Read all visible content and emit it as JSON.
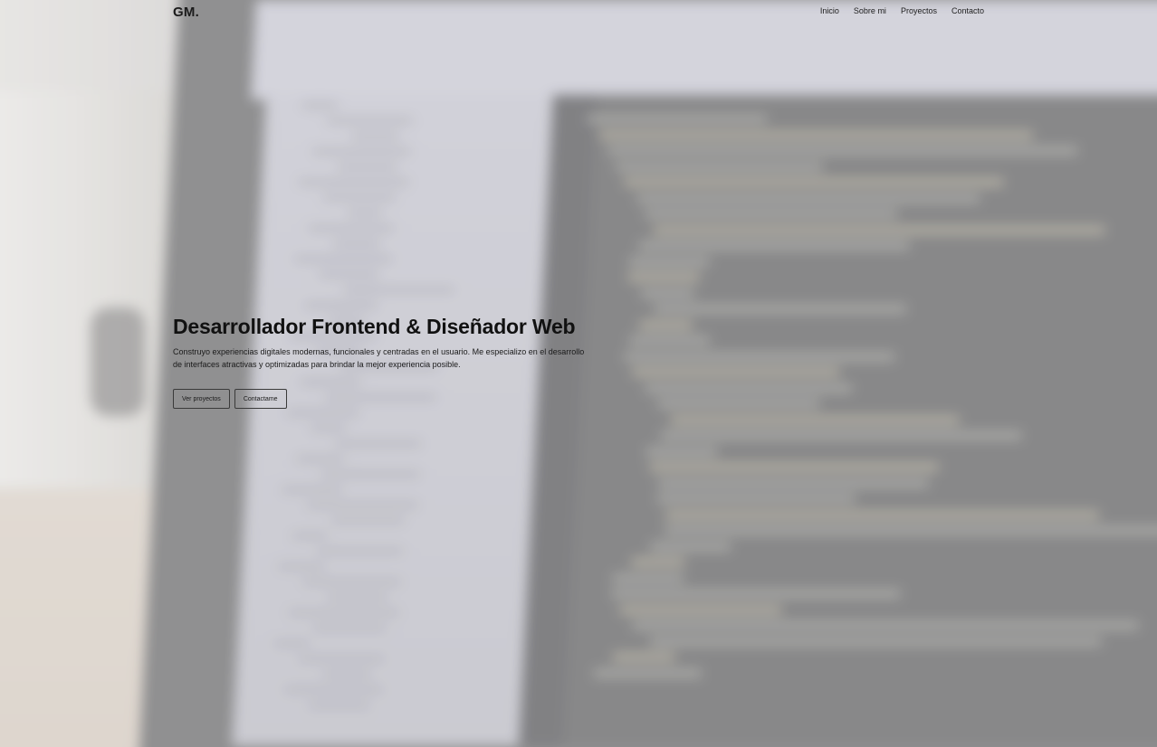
{
  "header": {
    "logo": "GM.",
    "nav": [
      {
        "label": "Inicio"
      },
      {
        "label": "Sobre mi"
      },
      {
        "label": "Proyectos"
      },
      {
        "label": "Contacto"
      }
    ]
  },
  "hero": {
    "title": "Desarrollador Frontend & Diseñador Web",
    "description": "Construyo experiencias digitales modernas, funcionales y centradas en el usuario. Me especializo en el desarrollo de interfaces atractivas y optimizadas para brindar la mejor experiencia posible.",
    "primary_button": "Ver proyectos",
    "secondary_button": "Contactame"
  },
  "background": {
    "image": "blurred-laptop-code-photo"
  }
}
